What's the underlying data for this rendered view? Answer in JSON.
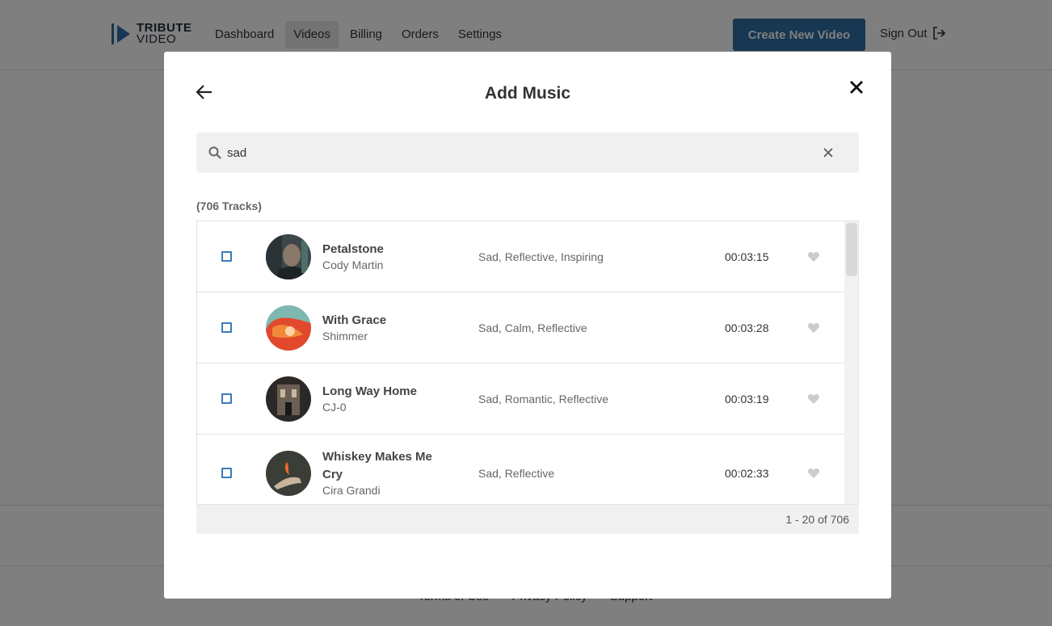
{
  "app": {
    "logo_line1": "TRIBUTE",
    "logo_line2": "VIDEO",
    "nav": [
      "Dashboard",
      "Videos",
      "Billing",
      "Orders",
      "Settings"
    ],
    "create_button": "Create New Video",
    "sign_out": "Sign Out",
    "footer": [
      "Terms of Use",
      "Privacy Policy",
      "Support"
    ]
  },
  "modal": {
    "title": "Add Music",
    "search_value": "sad",
    "track_count": "(706 Tracks)",
    "pager": "1 - 20 of 706"
  },
  "tracks": [
    {
      "title": "Petalstone",
      "artist": "Cody Martin",
      "tags": "Sad, Reflective, Inspiring",
      "duration": "00:03:15"
    },
    {
      "title": "With Grace",
      "artist": "Shimmer",
      "tags": "Sad, Calm, Reflective",
      "duration": "00:03:28"
    },
    {
      "title": "Long Way Home",
      "artist": "CJ-0",
      "tags": "Sad, Romantic, Reflective",
      "duration": "00:03:19"
    },
    {
      "title": "Whiskey Makes Me Cry",
      "artist": "Cira Grandi",
      "tags": "Sad, Reflective",
      "duration": "00:02:33"
    }
  ],
  "colors": {
    "accent": "#2f6fa7",
    "checkbox": "#3a7bb8",
    "heart": "#cccccc"
  }
}
